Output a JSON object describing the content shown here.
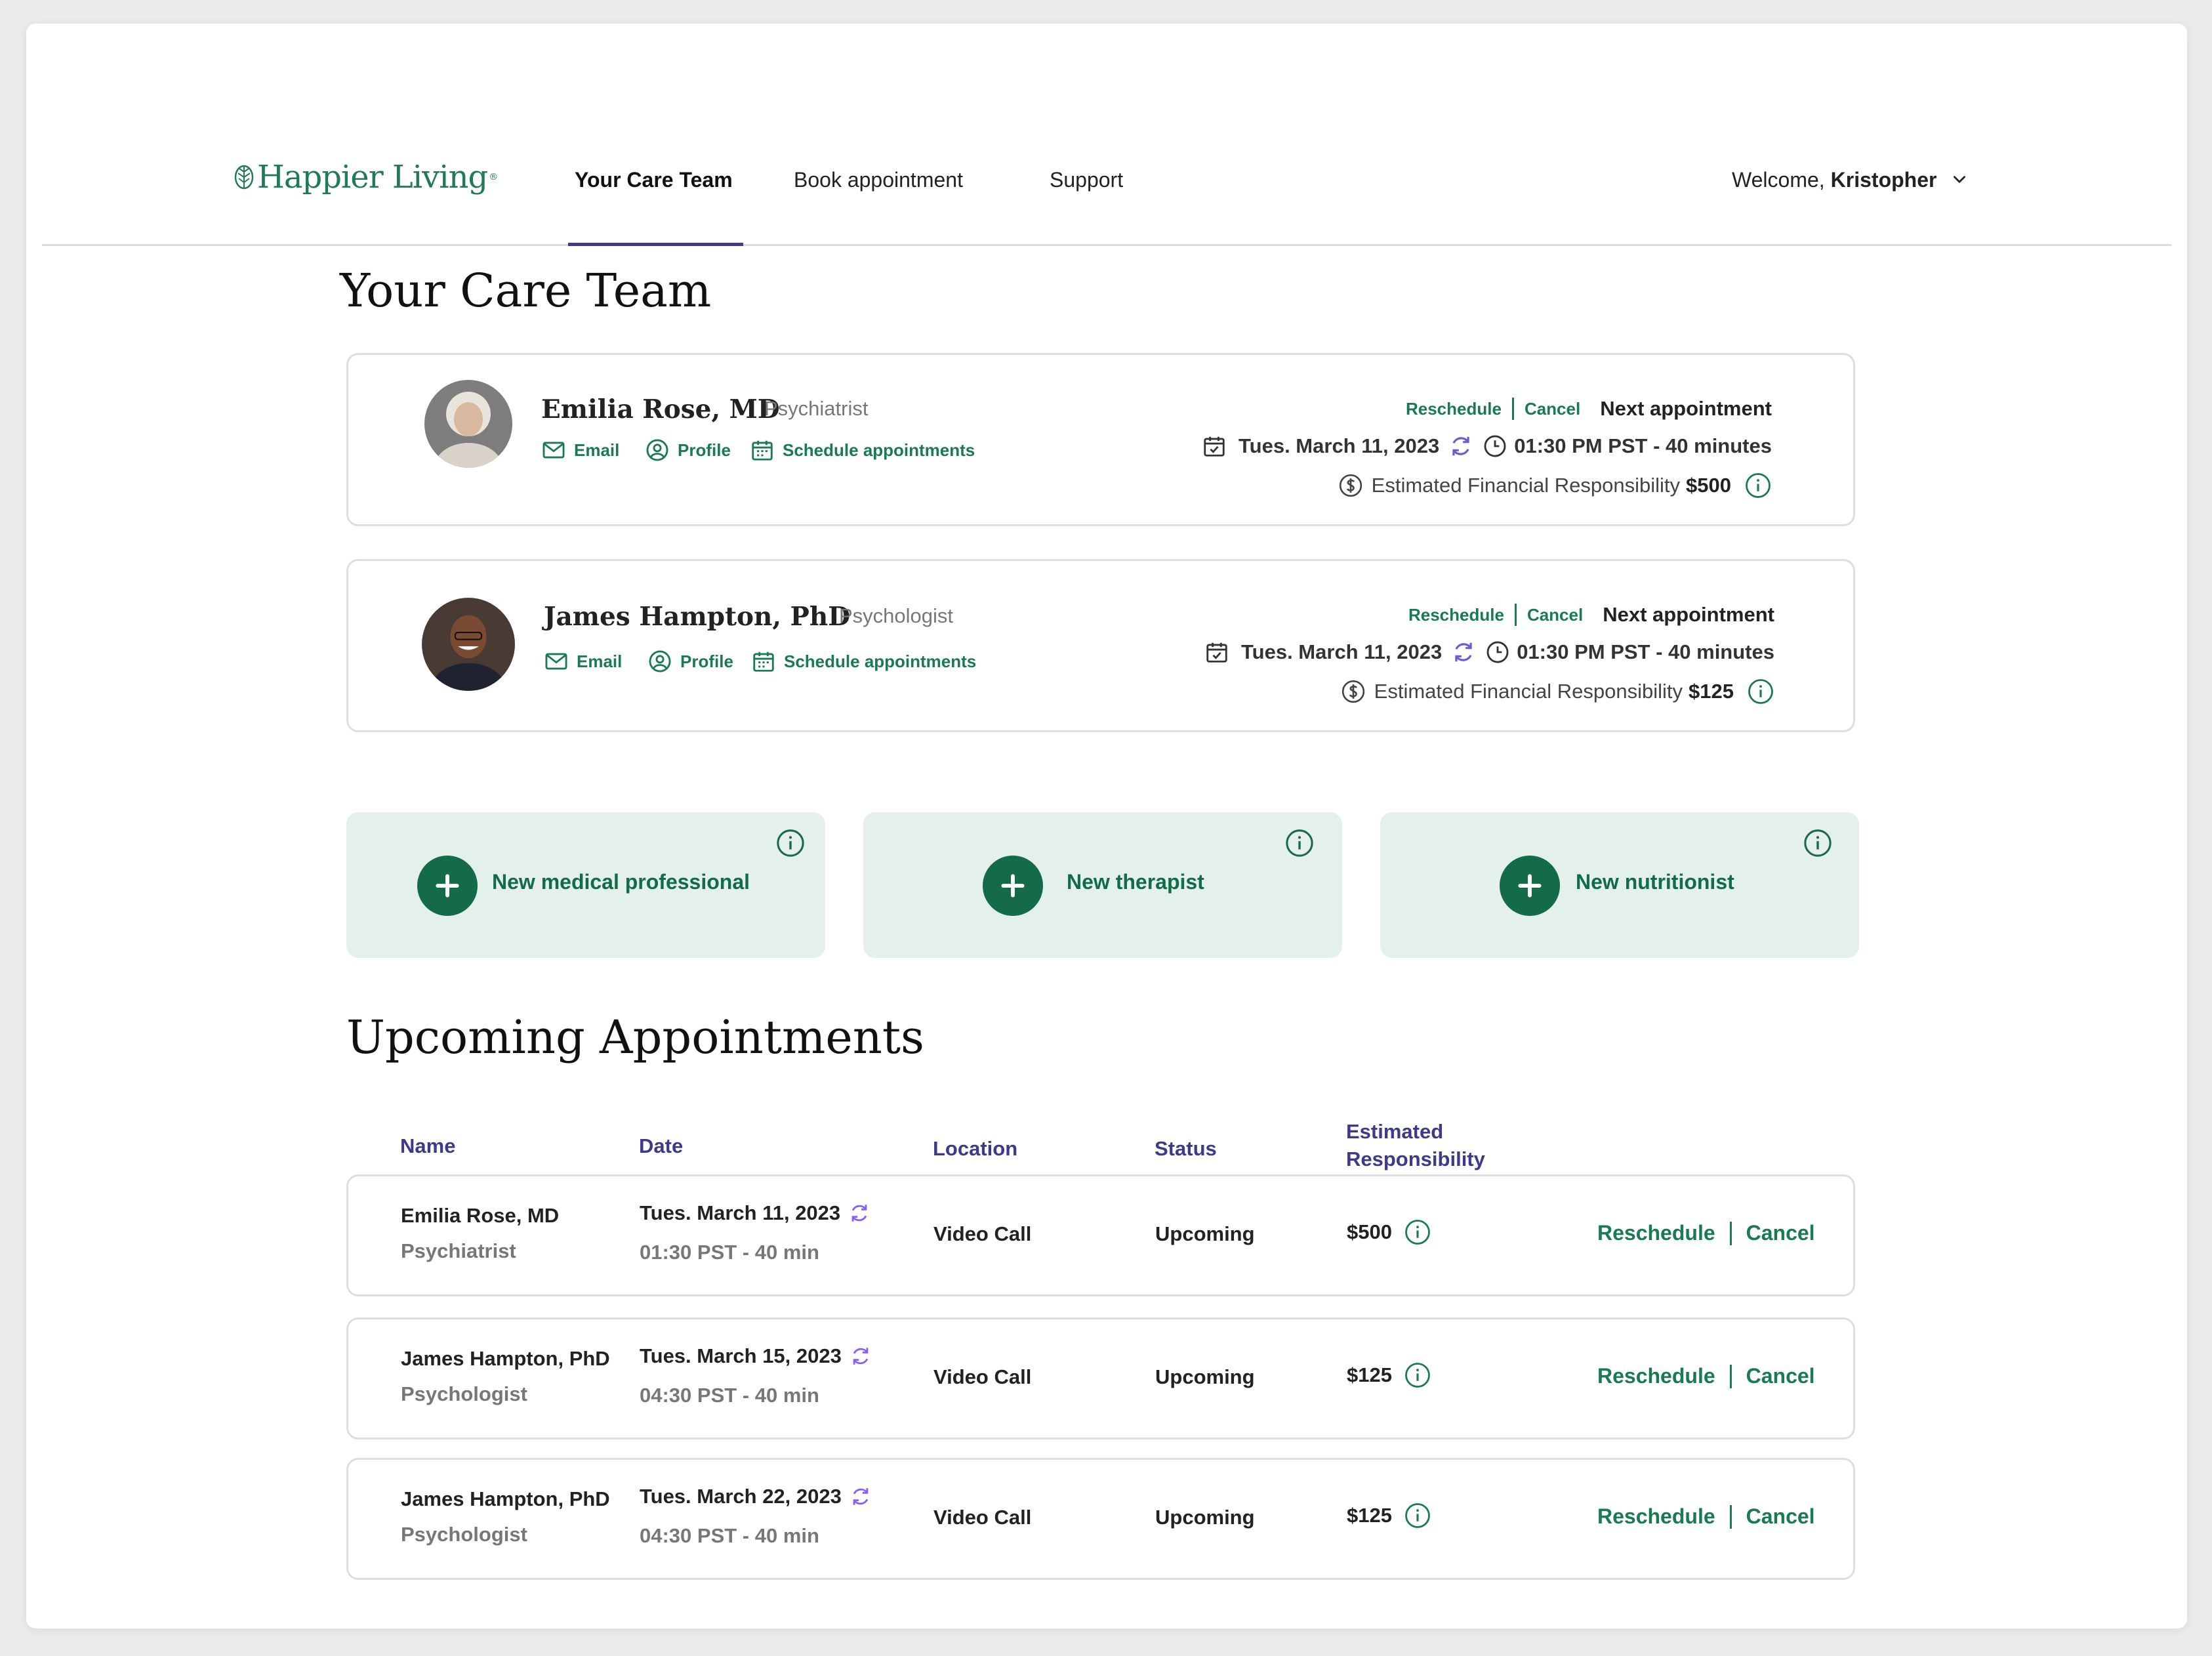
{
  "brand": {
    "name": "Happier Living",
    "mark": "®"
  },
  "nav": {
    "tabs": [
      {
        "label": "Your Care Team",
        "active": true
      },
      {
        "label": "Book appointment",
        "active": false
      },
      {
        "label": "Support",
        "active": false
      }
    ],
    "welcome_prefix": "Welcome,",
    "user_name": "Kristopher"
  },
  "care_team": {
    "title": "Your Care Team",
    "providers": [
      {
        "name": "Emilia Rose, MD",
        "role": "Psychiatrist",
        "email_label": "Email",
        "profile_label": "Profile",
        "schedule_label": "Schedule appointments",
        "reschedule_label": "Reschedule",
        "cancel_label": "Cancel",
        "next_label": "Next appointment",
        "date": "Tues. March 11, 2023",
        "time": "01:30 PM PST - 40 minutes",
        "responsibility_label": "Estimated Financial Responsibility",
        "responsibility_amount": "$500"
      },
      {
        "name": "James Hampton, PhD",
        "role": "Psychologist",
        "email_label": "Email",
        "profile_label": "Profile",
        "schedule_label": "Schedule appointments",
        "reschedule_label": "Reschedule",
        "cancel_label": "Cancel",
        "next_label": "Next appointment",
        "date": "Tues. March 11, 2023",
        "time": "01:30 PM PST - 40 minutes",
        "responsibility_label": "Estimated Financial Responsibility",
        "responsibility_amount": "$125"
      }
    ],
    "add_cards": [
      {
        "label": "New medical professional"
      },
      {
        "label": "New therapist"
      },
      {
        "label": "New nutritionist"
      }
    ]
  },
  "upcoming": {
    "title": "Upcoming Appointments",
    "columns": {
      "name": "Name",
      "date": "Date",
      "location": "Location",
      "status": "Status",
      "responsibility_line1": "Estimated",
      "responsibility_line2": "Responsibility"
    },
    "rows": [
      {
        "name": "Emilia Rose, MD",
        "role": "Psychiatrist",
        "date": "Tues. March 11, 2023",
        "time": "01:30 PST - 40 min",
        "location": "Video Call",
        "status": "Upcoming",
        "amount": "$500",
        "reschedule_label": "Reschedule",
        "cancel_label": "Cancel"
      },
      {
        "name": "James Hampton, PhD",
        "role": "Psychologist",
        "date": "Tues. March 15, 2023",
        "time": "04:30 PST - 40 min",
        "location": "Video Call",
        "status": "Upcoming",
        "amount": "$125",
        "reschedule_label": "Reschedule",
        "cancel_label": "Cancel"
      },
      {
        "name": "James Hampton, PhD",
        "role": "Psychologist",
        "date": "Tues. March 22, 2023",
        "time": "04:30 PST - 40 min",
        "location": "Video Call",
        "status": "Upcoming",
        "amount": "$125",
        "reschedule_label": "Reschedule",
        "cancel_label": "Cancel"
      }
    ]
  },
  "colors": {
    "brand_green": "#1a7a52",
    "dark_green": "#136b47",
    "card_tint": "#e3f0ec",
    "header_purple": "#3d3a8a",
    "recurring_purple": "#8b5cf6"
  }
}
